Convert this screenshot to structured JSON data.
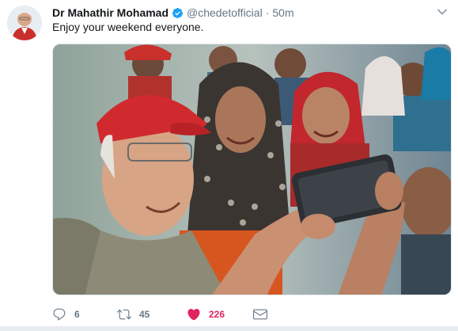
{
  "tweet": {
    "author_name": "Dr Mahathir Mohamad",
    "handle": "@chedetofficial",
    "separator": "·",
    "time": "50m",
    "text": "Enjoy your weekend everyone.",
    "verified": true,
    "media_icon": "photo",
    "actions": {
      "reply_count": "6",
      "retweet_count": "45",
      "like_count": "226",
      "liked": true
    }
  },
  "icons": {
    "verified": "verified-badge-icon",
    "caret": "chevron-down-icon",
    "reply": "reply-icon",
    "retweet": "retweet-icon",
    "like": "heart-icon",
    "message": "envelope-icon"
  },
  "colors": {
    "verified": "#1da1f2",
    "like": "#e0245e",
    "secondary_text": "#657786",
    "primary_text": "#14171a"
  }
}
